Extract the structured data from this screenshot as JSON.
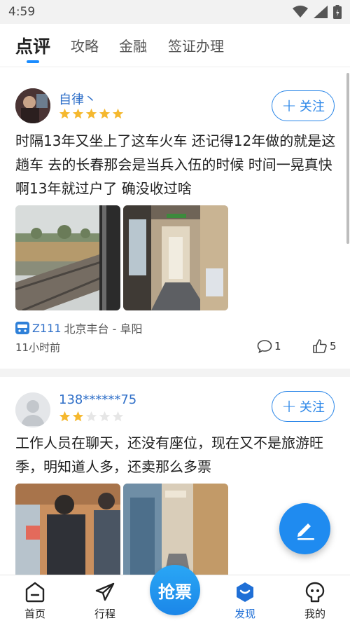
{
  "status_bar": {
    "time": "4:59"
  },
  "top_tabs": [
    {
      "label": "点评",
      "active": true
    },
    {
      "label": "攻略",
      "active": false
    },
    {
      "label": "金融",
      "active": false
    },
    {
      "label": "签证办理",
      "active": false
    }
  ],
  "posts": [
    {
      "username": "自律丶",
      "rating": 5,
      "follow_label": "关注",
      "text": "时隔13年又坐上了这车火车 还记得12年做的就是这趟车 去的长春那会是当兵入伍的时候 时间一晃真快啊13年就过户了 确没收过啥",
      "photos": [
        "train-window-field-photo",
        "train-corridor-photo"
      ],
      "train_no": "Z111",
      "route": "北京丰台 - 阜阳",
      "time_ago": "11小时前",
      "comments": "1",
      "likes": "5"
    },
    {
      "username": "138******75",
      "rating": 2,
      "follow_label": "关注",
      "text": "工作人员在聊天，还没有座位，现在又不是旅游旺季，明知道人多，还卖那么多票",
      "photos": [
        "crowded-carriage-photo",
        "carriage-aisle-photo"
      ]
    }
  ],
  "bottom_nav": [
    {
      "label": "首页",
      "icon": "home-icon"
    },
    {
      "label": "行程",
      "icon": "paper-plane-icon"
    },
    {
      "label": "抢票",
      "icon": "grab-ticket-button"
    },
    {
      "label": "发现",
      "icon": "discover-icon",
      "active": true
    },
    {
      "label": "我的",
      "icon": "profile-icon"
    }
  ],
  "colors": {
    "accent": "#1a8cff",
    "link": "#2f6fc8",
    "star": "#f5b82e"
  }
}
